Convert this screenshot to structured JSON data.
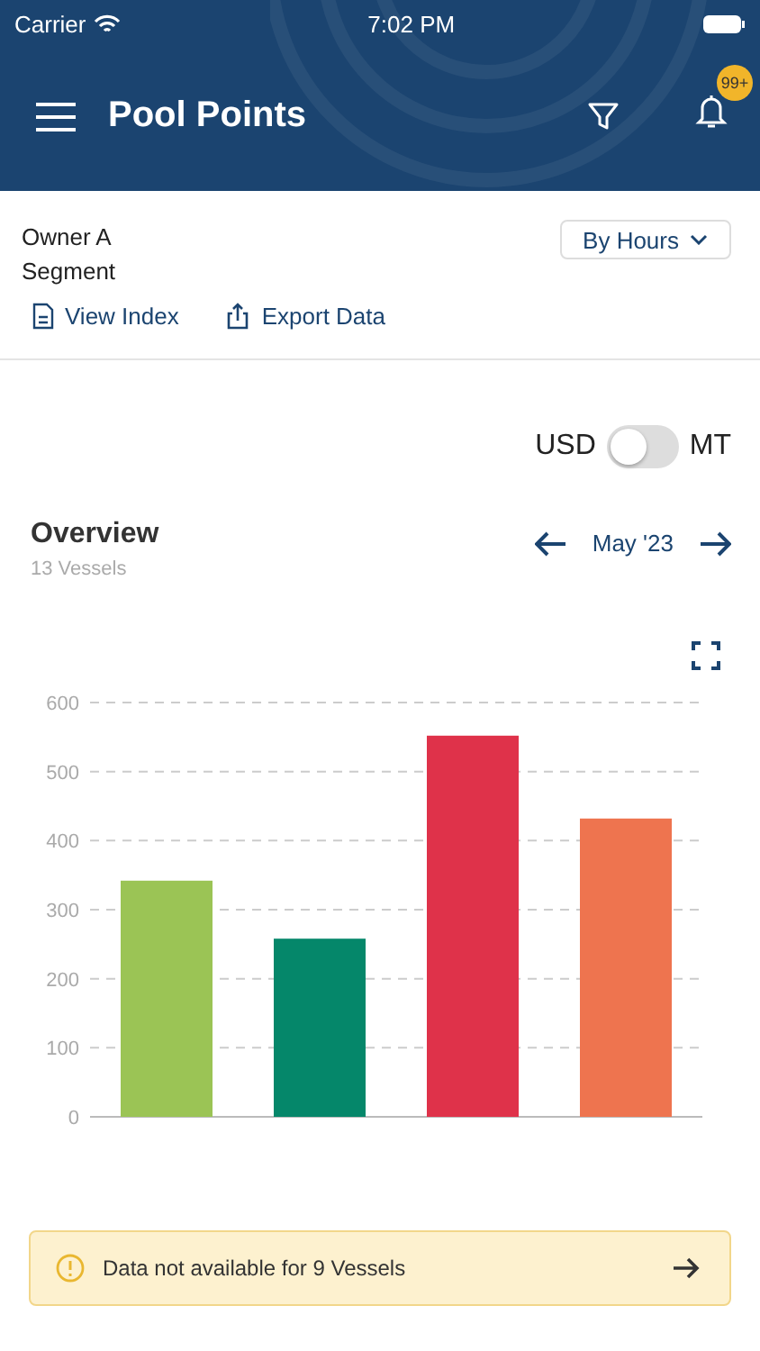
{
  "status_bar": {
    "carrier": "Carrier",
    "time": "7:02 PM"
  },
  "header": {
    "title": "Pool Points",
    "badge": "99+"
  },
  "filter": {
    "lines": [
      "Owner A",
      "Segment"
    ],
    "dropdown": "By Hours"
  },
  "actions": [
    "View Index",
    "Export Data"
  ],
  "unit_toggle": {
    "left": "USD",
    "right": "MT",
    "on": false
  },
  "overview": {
    "title": "Overview",
    "subtitle": "13 Vessels",
    "period": "May '23",
    "chart_data": {
      "type": "bar",
      "stacked": true,
      "grid": true,
      "ylim": [
        0,
        600
      ],
      "yticks": [
        0,
        100,
        200,
        300,
        400,
        500,
        600
      ],
      "series": [
        {
          "color": "#9bc455",
          "values": [
            342,
            null,
            null,
            null
          ]
        },
        {
          "color": "#05876a",
          "values": [
            null,
            258,
            null,
            null
          ]
        },
        {
          "color": "#df324a",
          "values": [
            null,
            null,
            552,
            null
          ]
        },
        {
          "color": "#ee744f",
          "values": [
            null,
            null,
            null,
            432
          ]
        }
      ]
    }
  },
  "notice": {
    "text": "Data not available for 9 Vessels"
  }
}
